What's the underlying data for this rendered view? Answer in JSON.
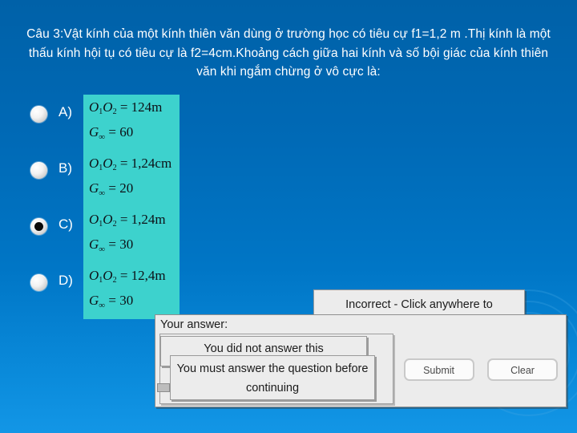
{
  "question": {
    "text": "Câu 3:Vật kính của một kính thiên văn dùng ở trường học có tiêu cự f1=1,2 m .Thị kính là một thấu kính hội tụ có tiêu cự là f2=4cm.Khoảng cách giữa hai kính và số bội giác của kính thiên văn khi ngắm chừng ở vô cực là:"
  },
  "choices": [
    {
      "letter": "A)",
      "selected": false,
      "line1_lhs": "O",
      "line1": "O₁O₂ = 124m",
      "line2": "G∞ = 60",
      "distance": "124m",
      "magnification": "60"
    },
    {
      "letter": "B)",
      "selected": false,
      "line1": "O₁O₂ = 1,24cm",
      "line2": "G∞ = 20",
      "distance": "1,24cm",
      "magnification": "20"
    },
    {
      "letter": "C)",
      "selected": true,
      "line1": "O₁O₂ = 1,24m",
      "line2": "G∞ = 30",
      "distance": "1,24m",
      "magnification": "30"
    },
    {
      "letter": "D)",
      "selected": false,
      "line1": "O₁O₂ = 12,4m",
      "line2": "G∞ = 30",
      "distance": "12,4m",
      "magnification": "30"
    }
  ],
  "dialogs": {
    "incorrect": "Incorrect - Click anywhere to",
    "your_answer_label": "Your answer:",
    "not_answered": "You did not answer this",
    "must_answer": "You must answer the question before continuing"
  },
  "buttons": {
    "submit": "Submit",
    "clear": "Clear"
  },
  "colors": {
    "background_top": "#0061a8",
    "background_bottom": "#1396e6",
    "formula_box": "#3dd2cd",
    "dialog_face": "#ececec",
    "text_light": "#ffffff"
  }
}
